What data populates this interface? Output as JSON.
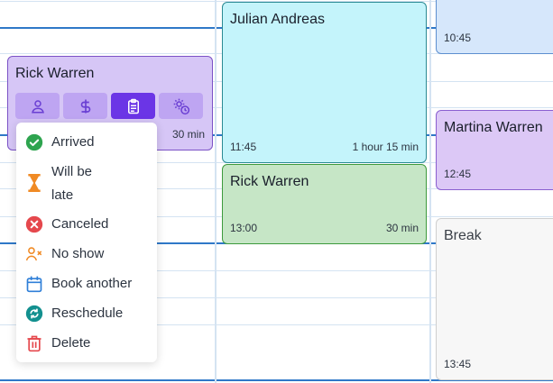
{
  "appointments": {
    "rick_warren_1": {
      "name": "Rick Warren",
      "duration": "30 min"
    },
    "julian": {
      "name": "Julian Andreas",
      "time": "11:45",
      "duration": "1 hour 15 min"
    },
    "rick_warren_2": {
      "name": "Rick Warren",
      "time": "13:00",
      "duration": "30 min"
    },
    "top_right": {
      "time": "10:45"
    },
    "martina": {
      "name": "Martina Warren",
      "time": "12:45"
    },
    "break_block": {
      "name": "Break",
      "time": "13:45"
    }
  },
  "toolbar": {
    "icons": [
      "person-icon",
      "dollar-icon",
      "clipboard-icon",
      "gear-clock-icon"
    ],
    "active_index": 2
  },
  "status_menu": {
    "items": [
      {
        "label": "Arrived",
        "icon": "check-circle-icon",
        "color": "#2ea44f"
      },
      {
        "label": "Will be late",
        "icon": "hourglass-icon",
        "color": "#f08a24"
      },
      {
        "label": "Canceled",
        "icon": "x-circle-icon",
        "color": "#e5484d"
      },
      {
        "label": "No show",
        "icon": "person-x-icon",
        "color": "#f08a24"
      },
      {
        "label": "Book another",
        "icon": "calendar-icon",
        "color": "#2f7fd8"
      },
      {
        "label": "Reschedule",
        "icon": "reschedule-icon",
        "color": "#13908f"
      },
      {
        "label": "Delete",
        "icon": "trash-icon",
        "color": "#e5484d"
      }
    ]
  }
}
